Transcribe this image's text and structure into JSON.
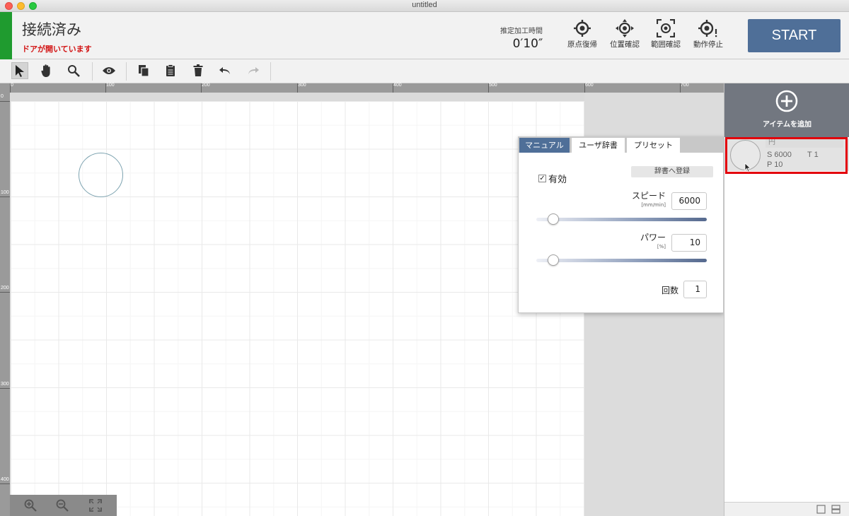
{
  "window": {
    "title": "untitled"
  },
  "header": {
    "connection_status": "接続済み",
    "door_warning": "ドアが開いています",
    "estimated_time_label": "推定加工時間",
    "estimated_time_value": "0′10″",
    "buttons": [
      {
        "label": "原点復帰",
        "icon": "home-target-icon"
      },
      {
        "label": "位置確認",
        "icon": "position-check-icon"
      },
      {
        "label": "範囲確認",
        "icon": "area-check-icon"
      },
      {
        "label": "動作停止",
        "icon": "stop-icon"
      }
    ],
    "start_label": "START"
  },
  "toolbar": {
    "tools": [
      "select-arrow-icon",
      "hand-icon",
      "magnify-icon",
      "eye-icon",
      "copy-icon",
      "paste-icon",
      "trash-icon",
      "undo-icon",
      "redo-icon"
    ]
  },
  "rulers": {
    "top_labels": [
      "0",
      "100",
      "200",
      "300",
      "400",
      "500",
      "600",
      "700"
    ],
    "left_labels": [
      "0",
      "100",
      "200",
      "300",
      "400"
    ]
  },
  "popup": {
    "tabs": [
      "マニュアル",
      "ユーザ辞書",
      "プリセット"
    ],
    "active_tab": "マニュアル",
    "enabled_label": "有効",
    "enabled_checked": "✓",
    "register_label": "辞書へ登録",
    "speed_label": "スピード",
    "speed_unit": "[mm/min]",
    "speed_value": "6000",
    "speed_slider_fraction": 0.1,
    "power_label": "パワー",
    "power_unit": "[%]",
    "power_value": "10",
    "power_slider_fraction": 0.1,
    "passes_label": "回数",
    "passes_value": "1"
  },
  "right_panel": {
    "add_label": "アイテムを追加",
    "items": [
      {
        "name": "円",
        "speed": "S 6000",
        "times": "T 1",
        "power": "P 10"
      }
    ]
  },
  "colors": {
    "connected": "#1f9b2f",
    "warning": "#d21414",
    "accent": "#4f6f98",
    "highlight": "#e3000b"
  }
}
